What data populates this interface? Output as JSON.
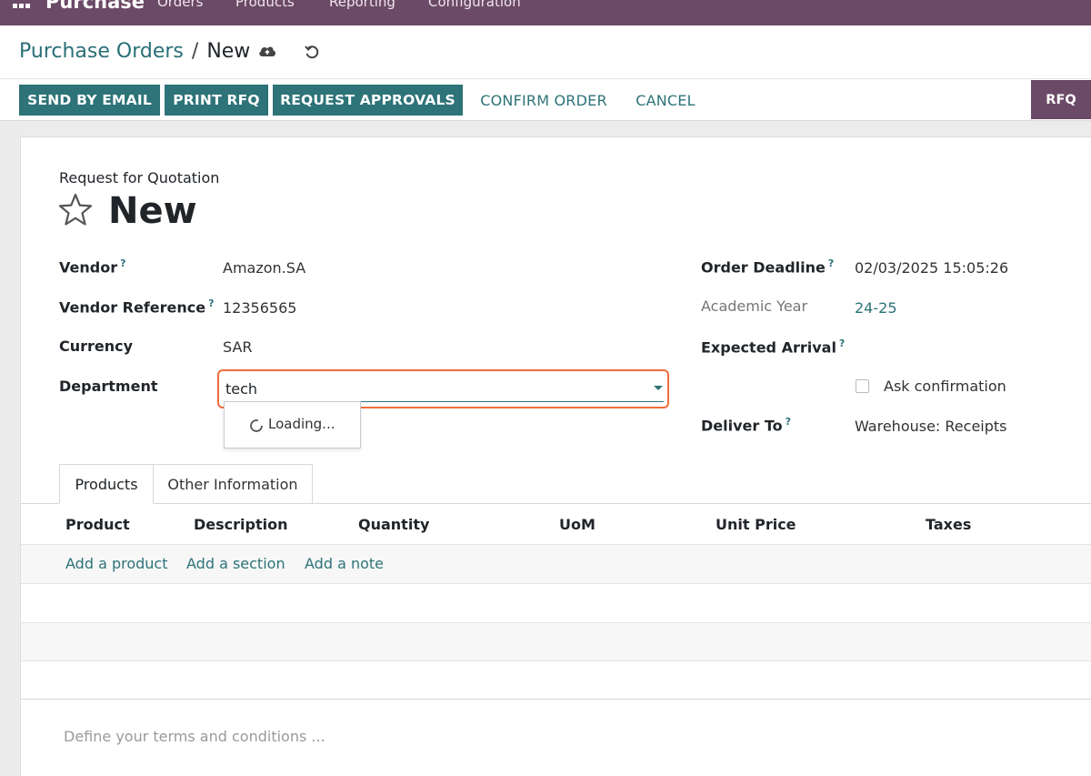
{
  "topnav": {
    "brand": "Purchase",
    "menu": [
      "Orders",
      "Products",
      "Reporting",
      "Configuration"
    ]
  },
  "breadcrumb": {
    "parent": "Purchase Orders",
    "separator": "/",
    "current": "New"
  },
  "toolbar": {
    "send_by_email": "SEND BY EMAIL",
    "print_rfq": "PRINT RFQ",
    "request_approvals": "REQUEST APPROVALS",
    "confirm_order": "CONFIRM ORDER",
    "cancel": "CANCEL",
    "status": "RFQ"
  },
  "form": {
    "title_label": "Request for Quotation",
    "title": "New",
    "vendor_label": "Vendor",
    "vendor_value": "Amazon.SA",
    "vendor_ref_label": "Vendor Reference",
    "vendor_ref_value": "12356565",
    "currency_label": "Currency",
    "currency_value": "SAR",
    "department_label": "Department",
    "department_value": "tech",
    "dropdown_loading": "Loading...",
    "order_deadline_label": "Order Deadline",
    "order_deadline_value": "02/03/2025 15:05:26",
    "academic_year_label": "Academic Year",
    "academic_year_value": "24-25",
    "expected_arrival_label": "Expected Arrival",
    "ask_confirmation_label": "Ask confirmation",
    "deliver_to_label": "Deliver To",
    "deliver_to_value": "Warehouse: Receipts",
    "help_mark": "?"
  },
  "tabs": [
    {
      "label": "Products"
    },
    {
      "label": "Other Information"
    }
  ],
  "table": {
    "headers": [
      "Product",
      "Description",
      "Quantity",
      "UoM",
      "Unit Price",
      "Taxes"
    ],
    "add_product": "Add a product",
    "add_section": "Add a section",
    "add_note": "Add a note"
  },
  "terms_placeholder": "Define your terms and conditions ...",
  "colors": {
    "brand": "#6b4a67",
    "primary": "#2d7378",
    "focus_border": "#f26c3b"
  }
}
